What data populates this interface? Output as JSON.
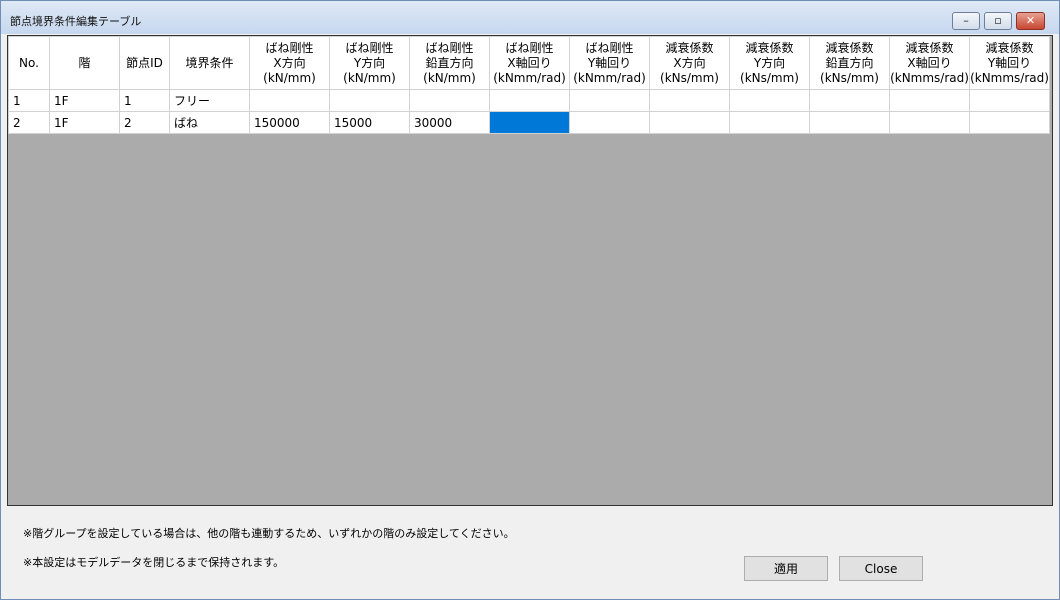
{
  "window": {
    "title": "節点境界条件編集テーブル"
  },
  "controls": {
    "minimize": "–",
    "maximize": "▫",
    "close": "✕"
  },
  "columns": [
    [
      "No."
    ],
    [
      "階"
    ],
    [
      "節点ID"
    ],
    [
      "境界条件"
    ],
    [
      "ばね剛性",
      "X方向",
      "(kN/mm)"
    ],
    [
      "ばね剛性",
      "Y方向",
      "(kN/mm)"
    ],
    [
      "ばね剛性",
      "鉛直方向",
      "(kN/mm)"
    ],
    [
      "ばね剛性",
      "X軸回り",
      "(kNmm/rad)"
    ],
    [
      "ばね剛性",
      "Y軸回り",
      "(kNmm/rad)"
    ],
    [
      "減衰係数",
      "X方向",
      "(kNs/mm)"
    ],
    [
      "減衰係数",
      "Y方向",
      "(kNs/mm)"
    ],
    [
      "減衰係数",
      "鉛直方向",
      "(kNs/mm)"
    ],
    [
      "減衰係数",
      "X軸回り",
      "(kNmms/rad)"
    ],
    [
      "減衰係数",
      "Y軸回り",
      "(kNmms/rad)"
    ]
  ],
  "rows": [
    [
      "1",
      "1F",
      "1",
      "フリー",
      "",
      "",
      "",
      "",
      "",
      "",
      "",
      "",
      "",
      ""
    ],
    [
      "2",
      "1F",
      "2",
      "ばね",
      "150000",
      "15000",
      "30000",
      "",
      "",
      "",
      "",
      "",
      "",
      ""
    ]
  ],
  "selected_cell": {
    "row": 1,
    "col": 7
  },
  "notes": [
    "※階グループを設定している場合は、他の階も連動するため、いずれかの階のみ設定してください。",
    "※本設定はモデルデータを閉じるまで保持されます。"
  ],
  "buttons": {
    "apply": "適用",
    "close": "Close"
  }
}
